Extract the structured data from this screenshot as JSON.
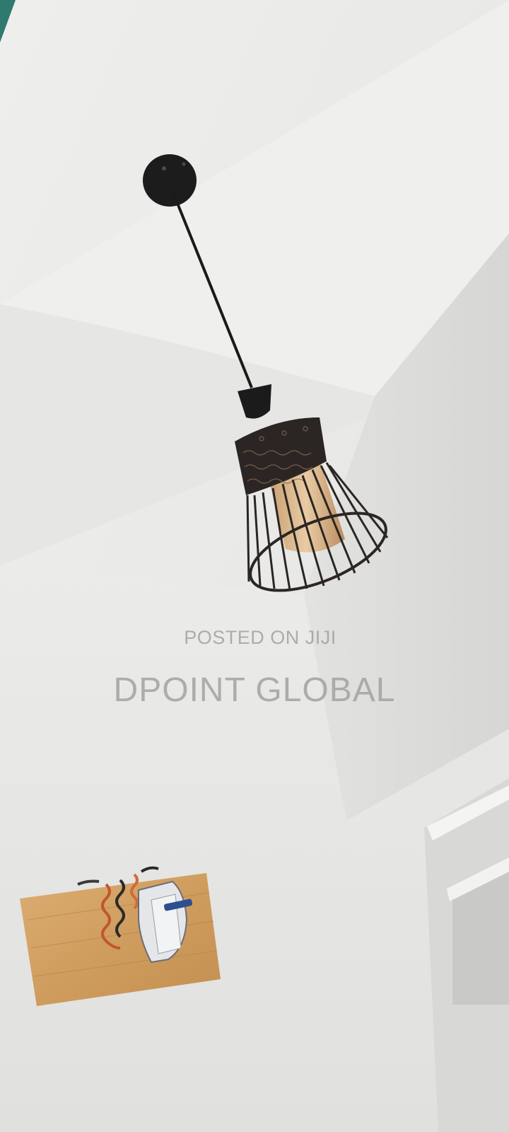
{
  "photo": {
    "subject": "pendant-cage-lamp",
    "watermark_line1": "POSTED ON JIJI",
    "watermark_line2": "DPOINT GLOBAL"
  },
  "colors": {
    "wall_light": "#efefed",
    "wall_shadow": "#dcdcda",
    "lamp_metal": "#2b2623",
    "bulb_glass": "#d9b48a",
    "wood_board": "#d3a264"
  }
}
